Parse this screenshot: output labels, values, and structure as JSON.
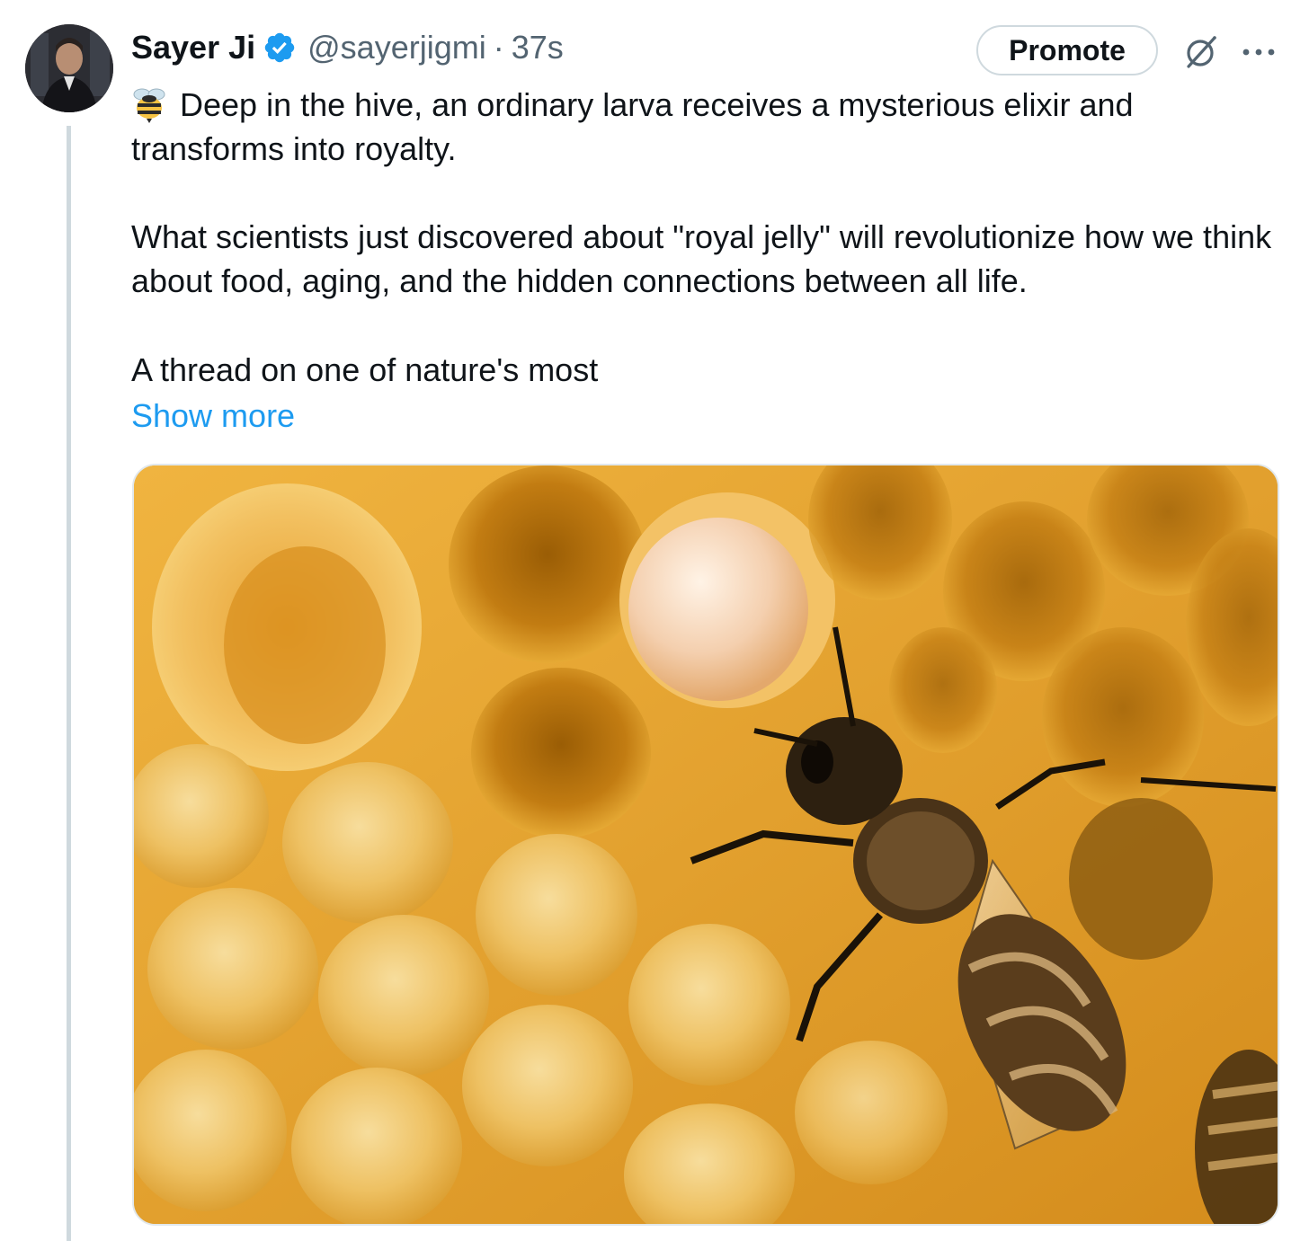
{
  "author": {
    "name": "Sayer Ji",
    "handle": "@sayerjigmi",
    "separator": "·",
    "time": "37s",
    "verified": true,
    "avatar_icon": "avatar-photo"
  },
  "actions": {
    "promote_label": "Promote",
    "grok_icon": "grok-icon",
    "more_icon": "more-options-icon"
  },
  "tweet": {
    "emoji": "bee-emoji",
    "line1": "Deep in the hive, an ordinary larva receives a mysterious elixir and transforms into royalty.",
    "line2": "What scientists just discovered about \"royal jelly\" will revolutionize how we think about food, aging, and the hidden connections between all life.",
    "line3": "A thread on one of nature's most",
    "show_more": "Show more"
  },
  "media": {
    "description_icon": "honeycomb-bee-photo"
  },
  "colors": {
    "link": "#1d9bf0",
    "verified": "#1d9bf0",
    "secondary_text": "#536471",
    "thread_line": "#cfd9de"
  }
}
